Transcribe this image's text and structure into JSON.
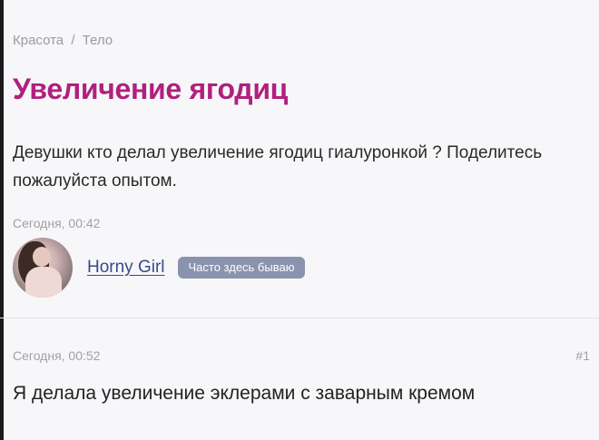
{
  "breadcrumb": {
    "category": "Красота",
    "separator": "/",
    "subcategory": "Тело"
  },
  "topic": {
    "title": "Увеличение ягодиц",
    "question": "Девушки кто делал увеличение ягодиц гиалуронкой ? Поделитесь пожалуйста опытом.",
    "timestamp": "Сегодня, 00:42"
  },
  "author": {
    "name": "Horny Girl",
    "badge": "Часто здесь бываю"
  },
  "reply": {
    "timestamp": "Сегодня, 00:52",
    "number": "#1",
    "text": "Я делала увеличение эклерами с заварным кремом"
  },
  "colors": {
    "title": "#b0207e",
    "link": "#3a4a8a",
    "badge_bg": "#8a93ae",
    "muted": "#a0a0a8"
  }
}
